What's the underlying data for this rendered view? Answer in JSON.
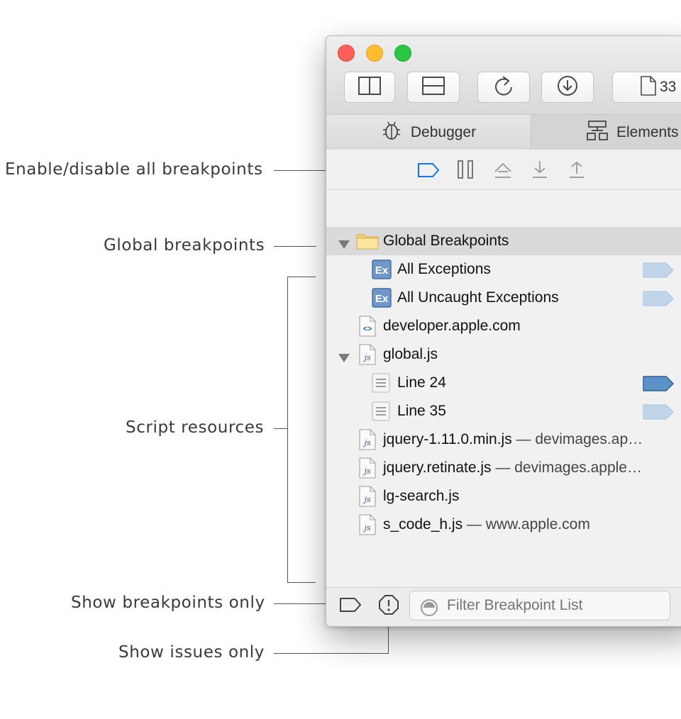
{
  "callouts": {
    "enable_all": "Enable/disable all breakpoints",
    "global": "Global breakpoints",
    "scripts": "Script resources",
    "show_breakpoints": "Show breakpoints only",
    "show_issues": "Show issues only"
  },
  "toolbar": {
    "resource_count": "33"
  },
  "tabs": [
    {
      "label": "Debugger",
      "icon": "bug-icon"
    },
    {
      "label": "Elements",
      "icon": "elements-tree-icon"
    }
  ],
  "tree": {
    "global_group": "Global Breakpoints",
    "all_exceptions": "All Exceptions",
    "all_uncaught": "All Uncaught Exceptions",
    "page_resource": "developer.apple.com",
    "global_js": "global.js",
    "line24": "Line 24",
    "line35": "Line 35",
    "jquery_min": "jquery-1.11.0.min.js",
    "jquery_min_sub": " — devimages.ap…",
    "jquery_retinate": "jquery.retinate.js",
    "jquery_retinate_sub": " — devimages.apple…",
    "lg_search": "lg-search.js",
    "s_code": "s_code_h.js",
    "s_code_sub": " — www.apple.com"
  },
  "filter": {
    "placeholder": "Filter Breakpoint List"
  },
  "colors": {
    "breakpoint_active": "#5b93c9",
    "breakpoint_inactive": "#c0d5ea",
    "accent": "#1a73e8"
  }
}
